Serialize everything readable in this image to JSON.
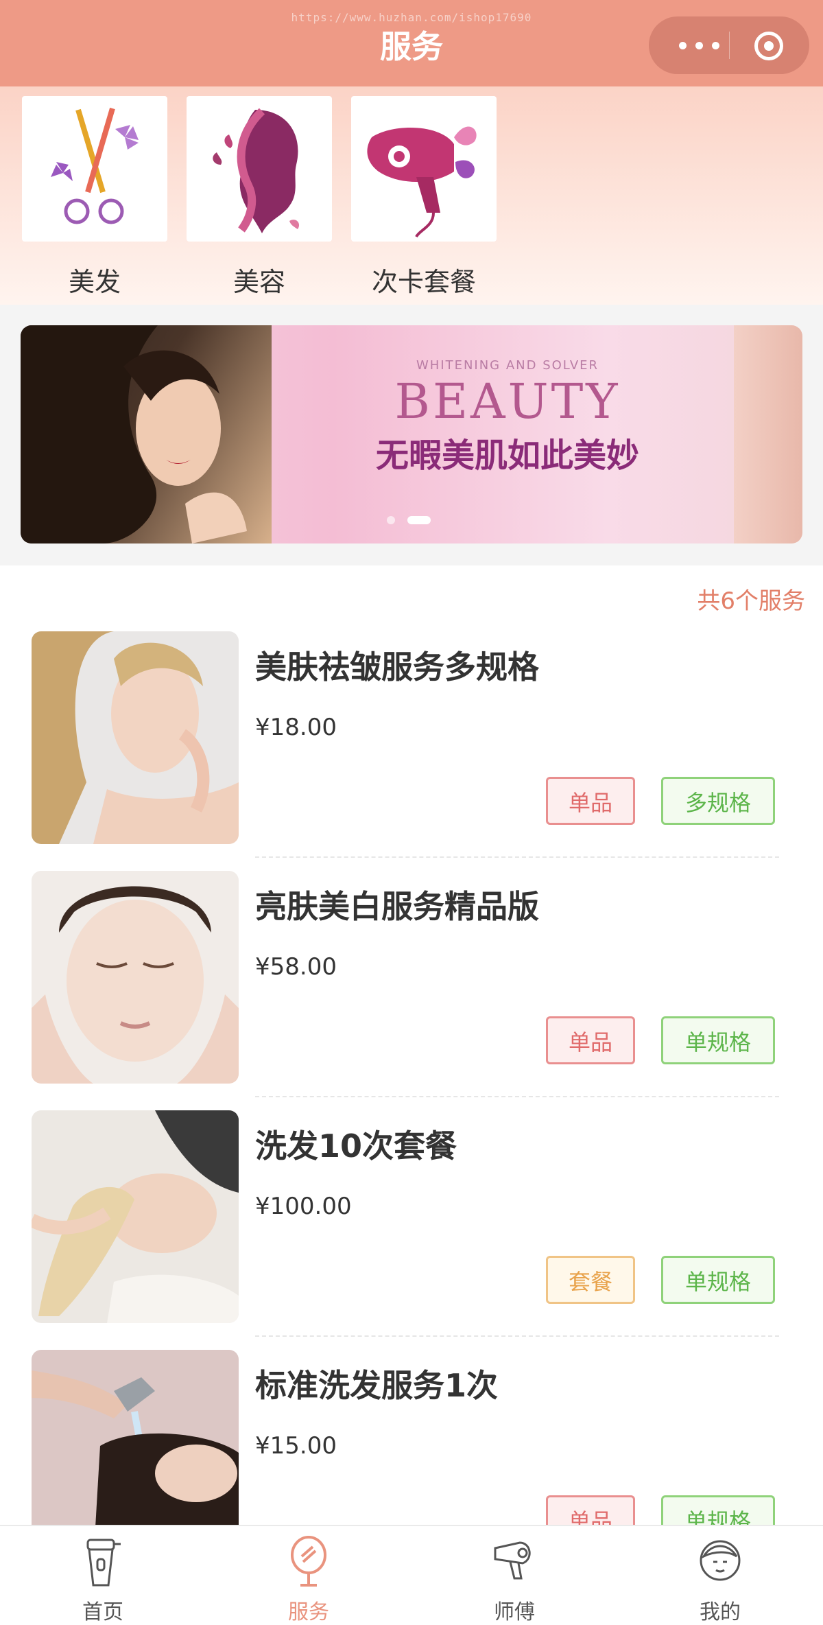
{
  "header": {
    "url": "https://www.huzhan.com/ishop17690",
    "title": "服务"
  },
  "categories": [
    {
      "label": "美发",
      "icon": "scissors-icon"
    },
    {
      "label": "美容",
      "icon": "woman-face-icon"
    },
    {
      "label": "次卡套餐",
      "icon": "hair-dryer-icon"
    }
  ],
  "banner": {
    "small_text": "WHITENING AND SOLVER",
    "big_text": "BEAUTY",
    "cn_text": "无暇美肌如此美妙",
    "active_dot": 2
  },
  "list": {
    "count_text": "共6个服务",
    "items": [
      {
        "name": "美肤祛皱服务多规格",
        "price": "¥18.00",
        "tag1": "单品",
        "tag2": "多规格"
      },
      {
        "name": "亮肤美白服务精品版",
        "price": "¥58.00",
        "tag1": "单品",
        "tag2": "单规格"
      },
      {
        "name": "洗发10次套餐",
        "price": "¥100.00",
        "tag1": "套餐",
        "tag2": "单规格"
      },
      {
        "name": "标准洗发服务1次",
        "price": "¥15.00",
        "tag1": "单品",
        "tag2": "单规格"
      }
    ]
  },
  "tabbar": [
    {
      "label": "首页",
      "icon": "shaver-icon",
      "active": false
    },
    {
      "label": "服务",
      "icon": "mirror-icon",
      "active": true
    },
    {
      "label": "师傅",
      "icon": "hair-dryer-icon",
      "active": false
    },
    {
      "label": "我的",
      "icon": "user-face-icon",
      "active": false
    }
  ],
  "colors": {
    "header": "#ee9a86",
    "accent": "#e9937e",
    "tag_pink": "#e06a6a",
    "tag_orange": "#e8a24a",
    "tag_green": "#5cb54a"
  }
}
